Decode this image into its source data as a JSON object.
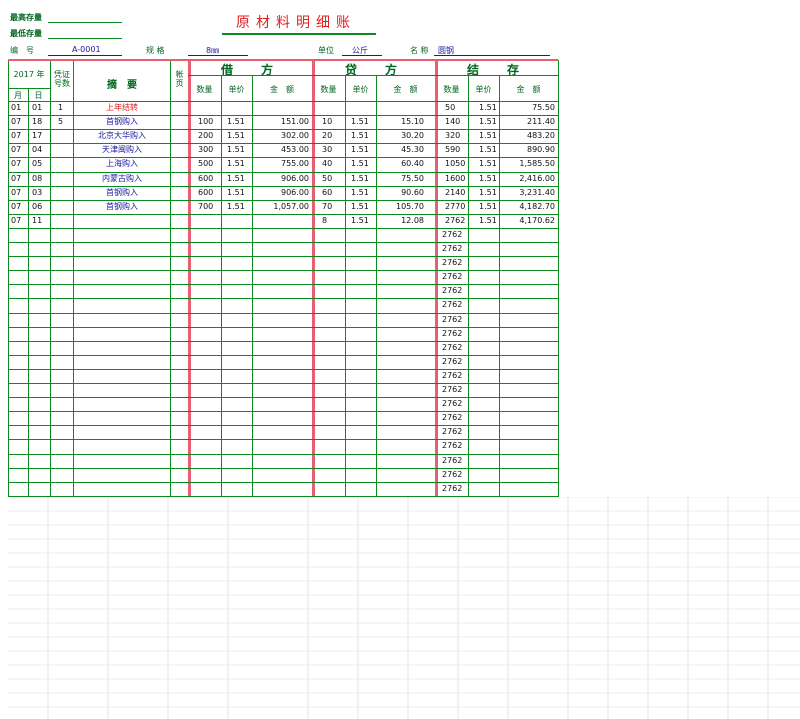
{
  "header": {
    "max_stock_label": "最高存量",
    "min_stock_label": "最低存量",
    "title": "原材料明细账",
    "code_label": "编　号",
    "code_value": "A-0001",
    "spec_label": "规 格",
    "spec_value": "8㎜",
    "unit_label": "单位",
    "unit_value": "公斤",
    "name_label": "名 称",
    "name_value": "圆钢"
  },
  "table": {
    "year_label": "2017 年",
    "month_label": "月",
    "day_label": "日",
    "voucher_label": "凭证号数",
    "summary_label": "摘　要",
    "page_label": "帐页",
    "debit_label": "借　方",
    "credit_label": "贷　方",
    "balance_label": "结　存",
    "qty_label": "数量",
    "price_label": "单价",
    "amount_label": "金　额",
    "rows": [
      {
        "m": "01",
        "d": "01",
        "v": "1",
        "s": "上年结转",
        "dq": "",
        "dp": "",
        "da": "",
        "cq": "",
        "cp": "",
        "ca": "",
        "bq": "50",
        "bp": "1.51",
        "ba": "75.50"
      },
      {
        "m": "07",
        "d": "18",
        "v": "5",
        "s": "首钢购入",
        "dq": "100",
        "dp": "1.51",
        "da": "151.00",
        "cq": "10",
        "cp": "1.51",
        "ca": "15.10",
        "bq": "140",
        "bp": "1.51",
        "ba": "211.40"
      },
      {
        "m": "07",
        "d": "17",
        "v": "",
        "s": "北京大华购入",
        "dq": "200",
        "dp": "1.51",
        "da": "302.00",
        "cq": "20",
        "cp": "1.51",
        "ca": "30.20",
        "bq": "320",
        "bp": "1.51",
        "ba": "483.20"
      },
      {
        "m": "07",
        "d": "04",
        "v": "",
        "s": "天津闽购入",
        "dq": "300",
        "dp": "1.51",
        "da": "453.00",
        "cq": "30",
        "cp": "1.51",
        "ca": "45.30",
        "bq": "590",
        "bp": "1.51",
        "ba": "890.90"
      },
      {
        "m": "07",
        "d": "05",
        "v": "",
        "s": "上海购入",
        "dq": "500",
        "dp": "1.51",
        "da": "755.00",
        "cq": "40",
        "cp": "1.51",
        "ca": "60.40",
        "bq": "1050",
        "bp": "1.51",
        "ba": "1,585.50"
      },
      {
        "m": "07",
        "d": "08",
        "v": "",
        "s": "内蒙古购入",
        "dq": "600",
        "dp": "1.51",
        "da": "906.00",
        "cq": "50",
        "cp": "1.51",
        "ca": "75.50",
        "bq": "1600",
        "bp": "1.51",
        "ba": "2,416.00"
      },
      {
        "m": "07",
        "d": "03",
        "v": "",
        "s": "首钢购入",
        "dq": "600",
        "dp": "1.51",
        "da": "906.00",
        "cq": "60",
        "cp": "1.51",
        "ca": "90.60",
        "bq": "2140",
        "bp": "1.51",
        "ba": "3,231.40"
      },
      {
        "m": "07",
        "d": "06",
        "v": "",
        "s": "首钢购入",
        "dq": "700",
        "dp": "1.51",
        "da": "1,057.00",
        "cq": "70",
        "cp": "1.51",
        "ca": "105.70",
        "bq": "2770",
        "bp": "1.51",
        "ba": "4,182.70"
      },
      {
        "m": "07",
        "d": "11",
        "v": "",
        "s": "",
        "dq": "",
        "dp": "",
        "da": "",
        "cq": "8",
        "cp": "1.51",
        "ca": "12.08",
        "bq": "2762",
        "bp": "1.51",
        "ba": "4,170.62"
      }
    ],
    "trailing_balance_qty": "2762",
    "trailing_row_count": 19
  }
}
